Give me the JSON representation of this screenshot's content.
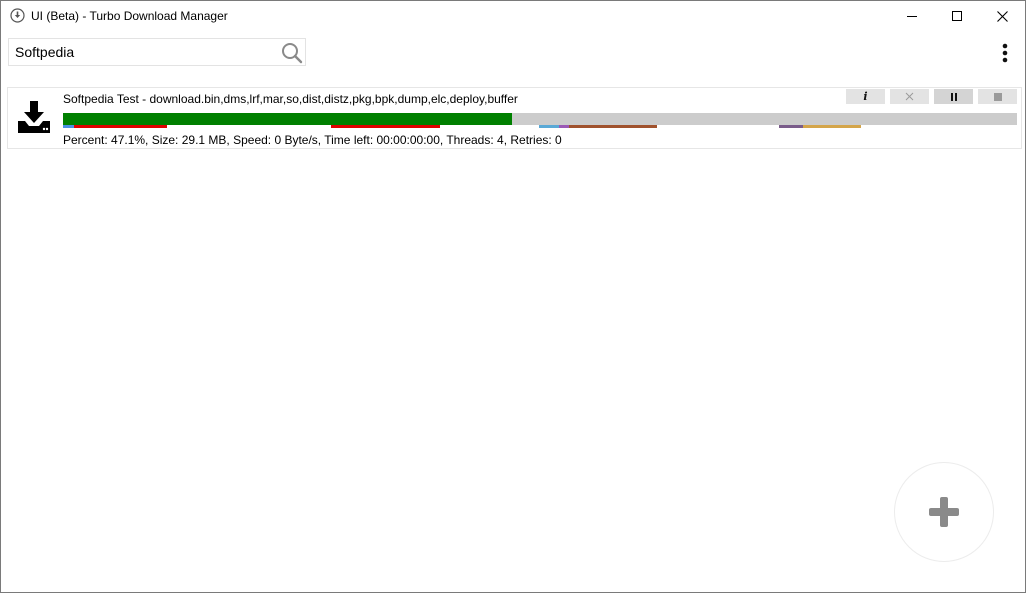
{
  "window": {
    "title": "UI (Beta) - Turbo Download Manager",
    "icons": {
      "app": "download-circle-icon",
      "minimize": "minimize-icon",
      "maximize": "maximize-icon",
      "close": "close-icon"
    }
  },
  "search": {
    "value": "Softpedia",
    "placeholder": "",
    "icon": "search-icon"
  },
  "menu": {
    "icon": "more-vertical-icon"
  },
  "downloads": [
    {
      "name": "Softpedia Test - download.bin,dms,lrf,mar,so,dist,distz,pkg,bpk,dump,elc,deploy,buffer",
      "stats": "Percent: 47.1%, Size: 29.1 MB, Speed: 0 Byte/s, Time left: 00:00:00:00, Threads: 4, Retries: 0",
      "percent": 47.1,
      "icon": "download-tray-icon",
      "controls": [
        "info-icon",
        "tools-icon",
        "pause-icon",
        "stop-icon"
      ],
      "colors": {
        "main_progress": "#008000",
        "remaining": "#cccccc"
      }
    }
  ],
  "fab": {
    "icon": "plus-icon",
    "color": "#8a8a8a"
  }
}
